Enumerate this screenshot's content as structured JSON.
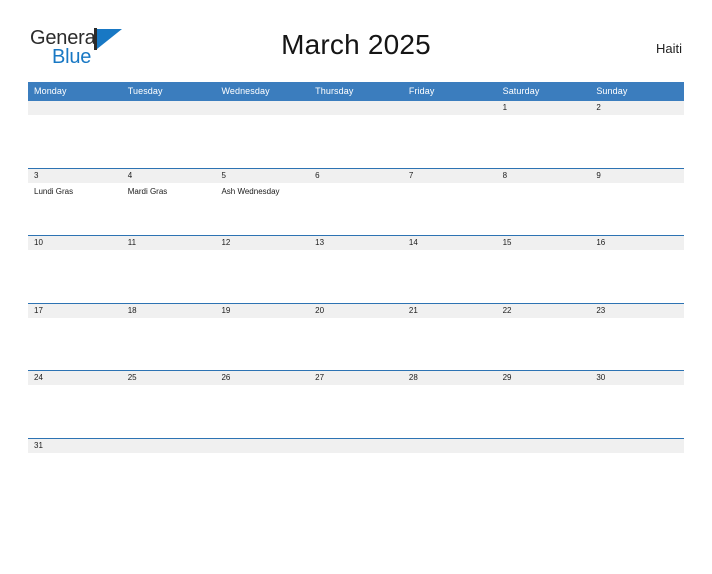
{
  "brand": {
    "name_part1": "General",
    "name_part2": "Blue",
    "mark": "sail-triangle"
  },
  "header": {
    "title": "March 2025",
    "country": "Haiti"
  },
  "calendar": {
    "weekdays": [
      "Monday",
      "Tuesday",
      "Wednesday",
      "Thursday",
      "Friday",
      "Saturday",
      "Sunday"
    ],
    "weeks": [
      {
        "days": [
          {
            "date": "",
            "event": ""
          },
          {
            "date": "",
            "event": ""
          },
          {
            "date": "",
            "event": ""
          },
          {
            "date": "",
            "event": ""
          },
          {
            "date": "",
            "event": ""
          },
          {
            "date": "1",
            "event": ""
          },
          {
            "date": "2",
            "event": ""
          }
        ]
      },
      {
        "days": [
          {
            "date": "3",
            "event": "Lundi Gras"
          },
          {
            "date": "4",
            "event": "Mardi Gras"
          },
          {
            "date": "5",
            "event": "Ash Wednesday"
          },
          {
            "date": "6",
            "event": ""
          },
          {
            "date": "7",
            "event": ""
          },
          {
            "date": "8",
            "event": ""
          },
          {
            "date": "9",
            "event": ""
          }
        ]
      },
      {
        "days": [
          {
            "date": "10",
            "event": ""
          },
          {
            "date": "11",
            "event": ""
          },
          {
            "date": "12",
            "event": ""
          },
          {
            "date": "13",
            "event": ""
          },
          {
            "date": "14",
            "event": ""
          },
          {
            "date": "15",
            "event": ""
          },
          {
            "date": "16",
            "event": ""
          }
        ]
      },
      {
        "days": [
          {
            "date": "17",
            "event": ""
          },
          {
            "date": "18",
            "event": ""
          },
          {
            "date": "19",
            "event": ""
          },
          {
            "date": "20",
            "event": ""
          },
          {
            "date": "21",
            "event": ""
          },
          {
            "date": "22",
            "event": ""
          },
          {
            "date": "23",
            "event": ""
          }
        ]
      },
      {
        "days": [
          {
            "date": "24",
            "event": ""
          },
          {
            "date": "25",
            "event": ""
          },
          {
            "date": "26",
            "event": ""
          },
          {
            "date": "27",
            "event": ""
          },
          {
            "date": "28",
            "event": ""
          },
          {
            "date": "29",
            "event": ""
          },
          {
            "date": "30",
            "event": ""
          }
        ]
      },
      {
        "days": [
          {
            "date": "31",
            "event": ""
          },
          {
            "date": "",
            "event": ""
          },
          {
            "date": "",
            "event": ""
          },
          {
            "date": "",
            "event": ""
          },
          {
            "date": "",
            "event": ""
          },
          {
            "date": "",
            "event": ""
          },
          {
            "date": "",
            "event": ""
          }
        ]
      }
    ]
  },
  "colors": {
    "header_blue": "#3b7dbe",
    "row_rule_blue": "#2d73b3",
    "date_band_gray": "#f0f0f0",
    "brand_blue": "#1878c4",
    "text_dark": "#1b1b1b"
  }
}
